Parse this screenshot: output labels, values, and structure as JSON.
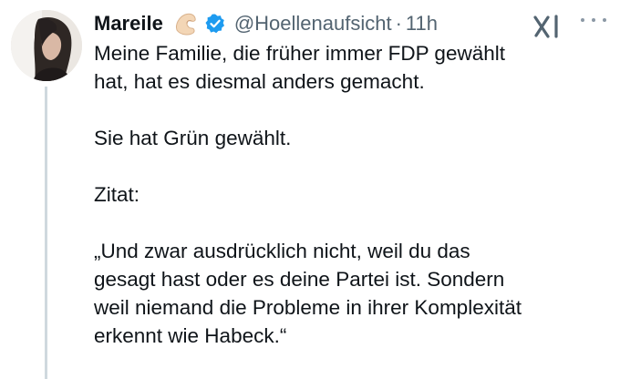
{
  "tweet": {
    "display_name": "Mareile",
    "handle": "@Hoellenaufsicht",
    "separator": "·",
    "time": "11h",
    "emoji_icon": "pinching-hand-emoji",
    "verified_icon": "verified-badge-icon",
    "accent_color": "#1d9bf0",
    "body": {
      "p1_l1": "Meine Familie, die früher immer FDP gewählt",
      "p1_l2": "hat, hat es diesmal anders gemacht.",
      "p2_l1": "Sie hat Grün gewählt.",
      "p3_l1": "Zitat:",
      "p4_l1": "„Und zwar ausdrücklich nicht, weil du das",
      "p4_l2": "gesagt hast oder es deine Partei ist. Sondern",
      "p4_l3": "weil niemand die Probleme in ihrer Komplexität",
      "p4_l4": "erkennt wie Habeck.“"
    }
  }
}
